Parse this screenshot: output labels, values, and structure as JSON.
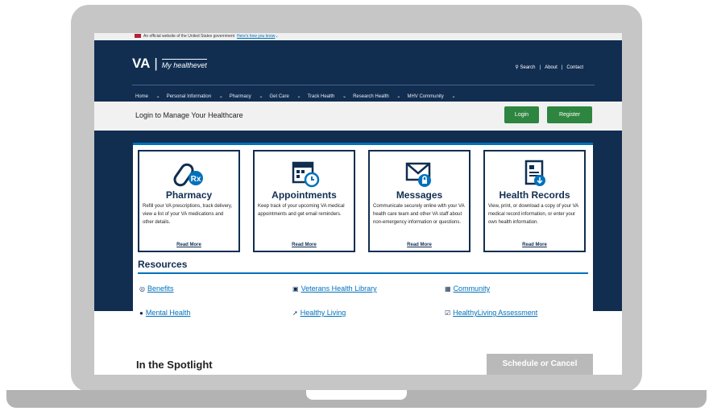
{
  "gov_banner": {
    "text": "An official website of the United States government",
    "link": "Here's how you know"
  },
  "header": {
    "va_logo": "VA",
    "divider": "|",
    "mhv_logo": "My healthevet",
    "utility": [
      "Search",
      "About",
      "Contact"
    ],
    "nav": [
      "Home",
      "Personal Information",
      "Pharmacy",
      "Get Care",
      "Track Health",
      "Research Health",
      "MHV Community"
    ]
  },
  "login_bar": {
    "text": "Login to Manage Your Healthcare",
    "login_label": "Login",
    "register_label": "Register"
  },
  "cards": [
    {
      "icon": "pill-rx-icon",
      "title": "Pharmacy",
      "desc": "Refill your VA prescriptions, track delivery, view a list of your VA medications and other details.",
      "link": "Read More"
    },
    {
      "icon": "calendar-clock-icon",
      "title": "Appointments",
      "desc": "Keep track of your upcoming VA medical appointments and get email reminders.",
      "link": "Read More"
    },
    {
      "icon": "envelope-lock-icon",
      "title": "Messages",
      "desc": "Communicate securely online with your VA health care team and other VA staff about non-emergency information or questions.",
      "link": "Read More"
    },
    {
      "icon": "health-record-icon",
      "title": "Health Records",
      "desc": "View, print, or download a copy of your VA medical record information, or enter your own health information.",
      "link": "Read More"
    }
  ],
  "resources": {
    "title": "Resources",
    "items": [
      {
        "label": "Benefits",
        "icon": "globe-icon"
      },
      {
        "label": "Veterans Health Library",
        "icon": "book-icon"
      },
      {
        "label": "Community",
        "icon": "building-icon"
      },
      {
        "label": "Mental Health",
        "icon": "brain-icon"
      },
      {
        "label": "Healthy Living",
        "icon": "runner-icon"
      },
      {
        "label": "HealthyLiving Assessment",
        "icon": "checklist-icon"
      }
    ]
  },
  "spotlight": {
    "title": "In the Spotlight",
    "schedule_label": "Schedule or Cancel"
  },
  "colors": {
    "navy": "#112e51",
    "accent_blue": "#0071bb",
    "green": "#2e8540",
    "laptop_gray": "#c6c6c6"
  }
}
